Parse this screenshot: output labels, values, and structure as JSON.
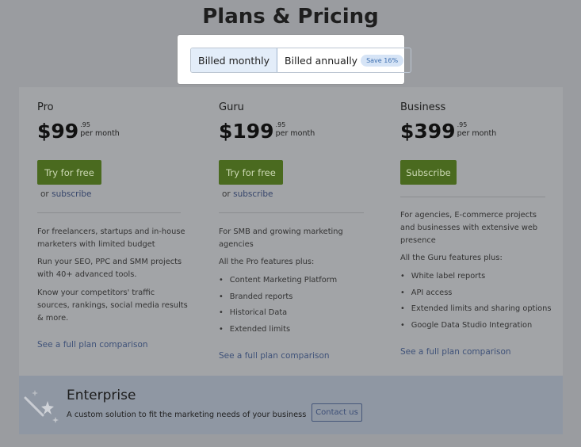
{
  "page": {
    "title": "Plans & Pricing"
  },
  "billing": {
    "monthly_label": "Billed monthly",
    "annual_label": "Billed annually",
    "save_badge": "Save 16%"
  },
  "plans": [
    {
      "name": "Pro",
      "price": "$99",
      "cents": ".95",
      "period": "per month",
      "cta": "Try for free",
      "alt_or": "or",
      "alt_link": "subscribe",
      "desc": [
        "For freelancers, startups and in-house marketers with limited budget",
        "Run your SEO, PPC and SMM projects with 40+ advanced tools.",
        "Know your competitors' traffic sources, rankings, social media results & more."
      ],
      "features_intro": "",
      "features": [],
      "compare": "See a full plan comparison"
    },
    {
      "name": "Guru",
      "price": "$199",
      "cents": ".95",
      "period": "per month",
      "cta": "Try for free",
      "alt_or": "or",
      "alt_link": "subscribe",
      "desc": [
        "For SMB and growing marketing agencies"
      ],
      "features_intro": "All the Pro features plus:",
      "features": [
        "Content Marketing Platform",
        "Branded reports",
        "Historical Data",
        "Extended limits"
      ],
      "compare": "See a full plan comparison"
    },
    {
      "name": "Business",
      "price": "$399",
      "cents": ".95",
      "period": "per month",
      "cta": "Subscribe",
      "alt_or": "",
      "alt_link": "",
      "desc": [
        "For agencies, E-commerce projects and businesses with extensive web presence"
      ],
      "features_intro": "All the Guru features plus:",
      "features": [
        "White label reports",
        "API access",
        "Extended limits and sharing options",
        "Google Data Studio Integration"
      ],
      "compare": "See a full plan comparison"
    }
  ],
  "enterprise": {
    "title": "Enterprise",
    "description": "A custom solution to fit the marketing needs of your business",
    "button": "Contact us",
    "icon": "magic-wand-icon"
  }
}
